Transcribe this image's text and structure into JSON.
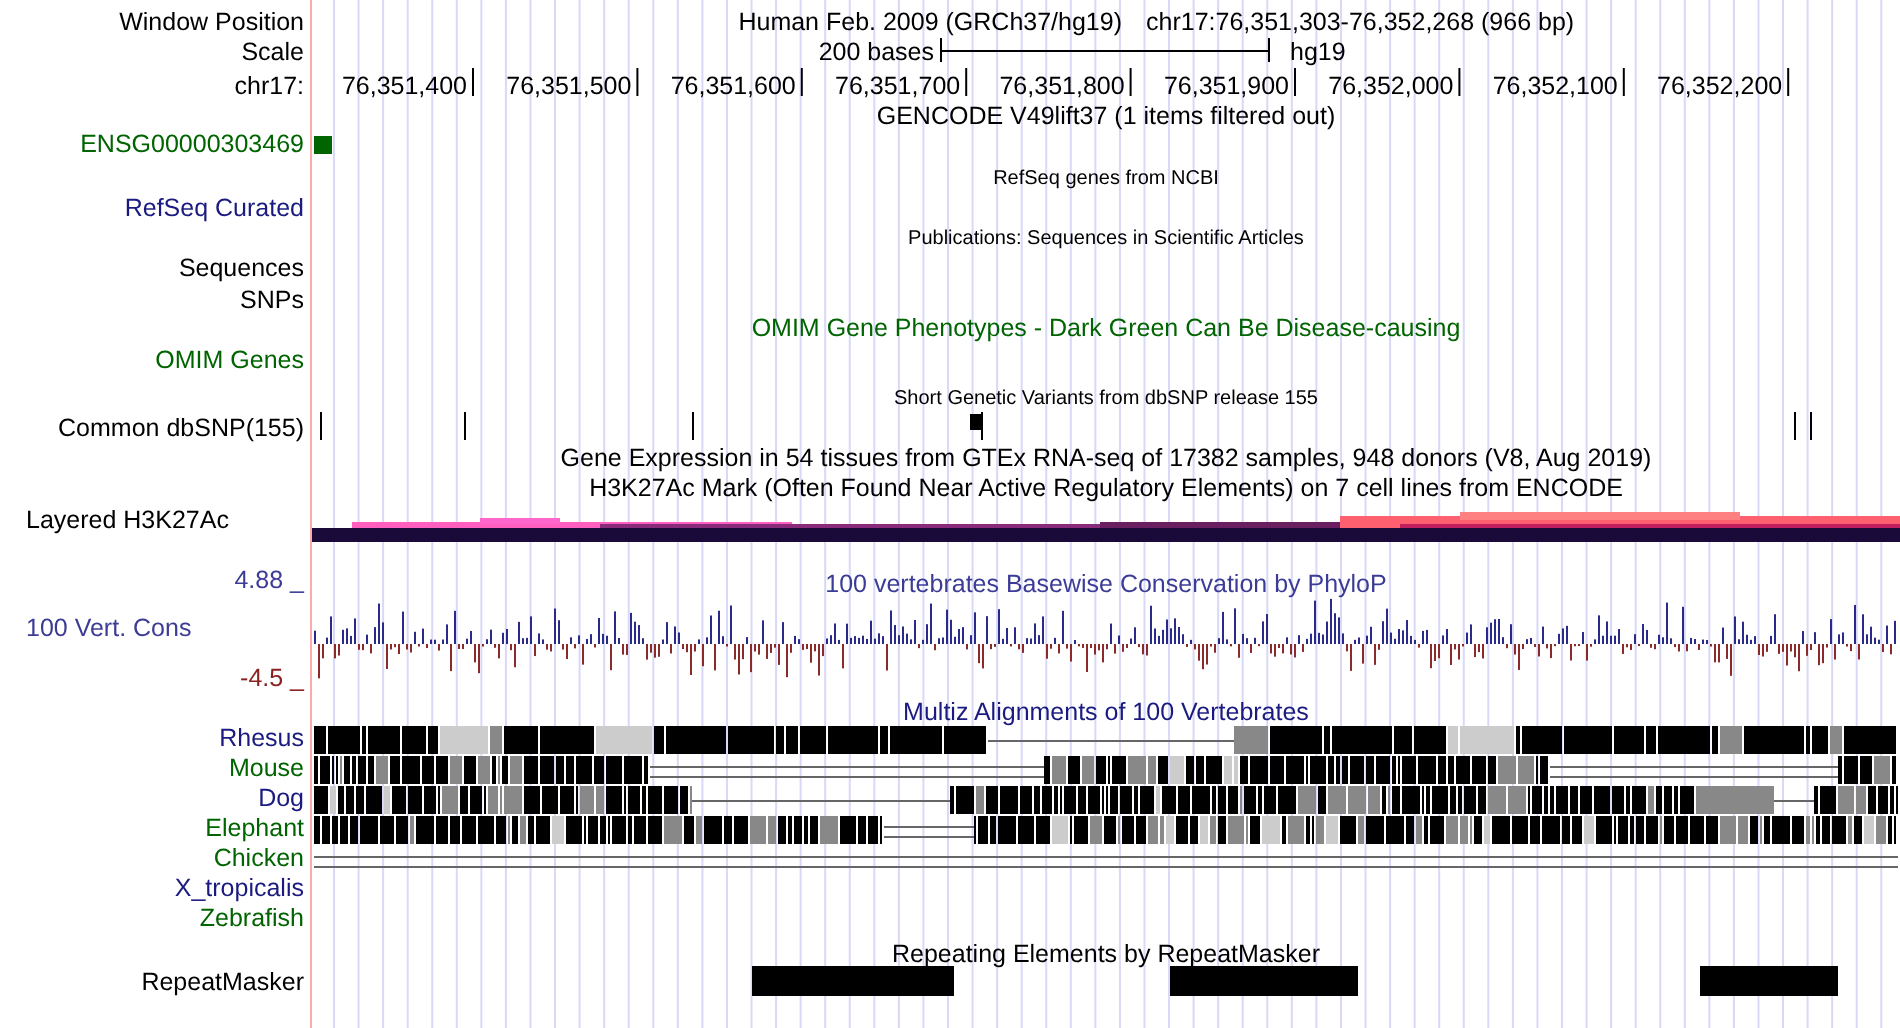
{
  "position": {
    "label": "Window Position",
    "assembly": "Human Feb. 2009 (GRCh37/hg19)",
    "range": "chr17:76,351,303-76,352,268 (966 bp)"
  },
  "scale": {
    "label": "Scale",
    "length": "200 bases",
    "assembly": "hg19"
  },
  "ruler": {
    "label": "chr17:",
    "ticks": [
      "76,351,400",
      "76,351,500",
      "76,351,600",
      "76,351,700",
      "76,351,800",
      "76,351,900",
      "76,352,000",
      "76,352,100",
      "76,352,200"
    ]
  },
  "tracks": [
    {
      "kind": "gene",
      "title": "GENCODE V49lift37 (1 items filtered out)",
      "labels": [
        "ENSG00000303469"
      ],
      "color": "#006400"
    },
    {
      "kind": "empty",
      "title": "RefSeq genes from NCBI",
      "labels": [
        "RefSeq Curated"
      ],
      "color": "#1a1a80"
    },
    {
      "kind": "empty2",
      "title": "Publications: Sequences in Scientific Articles",
      "labels": [
        "Sequences",
        "SNPs"
      ]
    },
    {
      "kind": "omim",
      "title": "OMIM Gene Phenotypes - Dark Green Can Be Disease-causing",
      "labels": [
        "OMIM Genes"
      ],
      "color": "#006400"
    },
    {
      "kind": "snp",
      "title": "Short Genetic Variants from dbSNP release 155",
      "labels": [
        "Common dbSNP(155)"
      ]
    },
    {
      "kind": "gtex",
      "title": "Gene Expression in 54 tissues from GTEx RNA-seq of 17382 samples, 948 donors (V8, Aug 2019)"
    },
    {
      "kind": "h3k27ac",
      "title": "H3K27Ac Mark (Often Found Near Active Regulatory Elements) on 7 cell lines from ENCODE",
      "labels": [
        "Layered H3K27Ac"
      ]
    },
    {
      "kind": "conservation",
      "title": "100 vertebrates Basewise Conservation by PhyloP",
      "labels": [
        "100 Vert. Cons"
      ],
      "max": "4.88 _",
      "min": "-4.5 _",
      "color": "#3c3c96"
    },
    {
      "kind": "multiz",
      "title": "Multiz Alignments of 100 Vertebrates",
      "color": "#1a1a80",
      "species": [
        {
          "name": "Rhesus",
          "color": "#1a1a80"
        },
        {
          "name": "Mouse",
          "color": "#006400"
        },
        {
          "name": "Dog",
          "color": "#1a1a80"
        },
        {
          "name": "Elephant",
          "color": "#006400"
        },
        {
          "name": "Chicken",
          "color": "#006400"
        },
        {
          "name": "X_tropicalis",
          "color": "#1a1a80"
        },
        {
          "name": "Zebrafish",
          "color": "#006400"
        }
      ]
    },
    {
      "kind": "repeats",
      "title": "Repeating Elements by RepeatMasker",
      "labels": [
        "RepeatMasker"
      ]
    }
  ]
}
